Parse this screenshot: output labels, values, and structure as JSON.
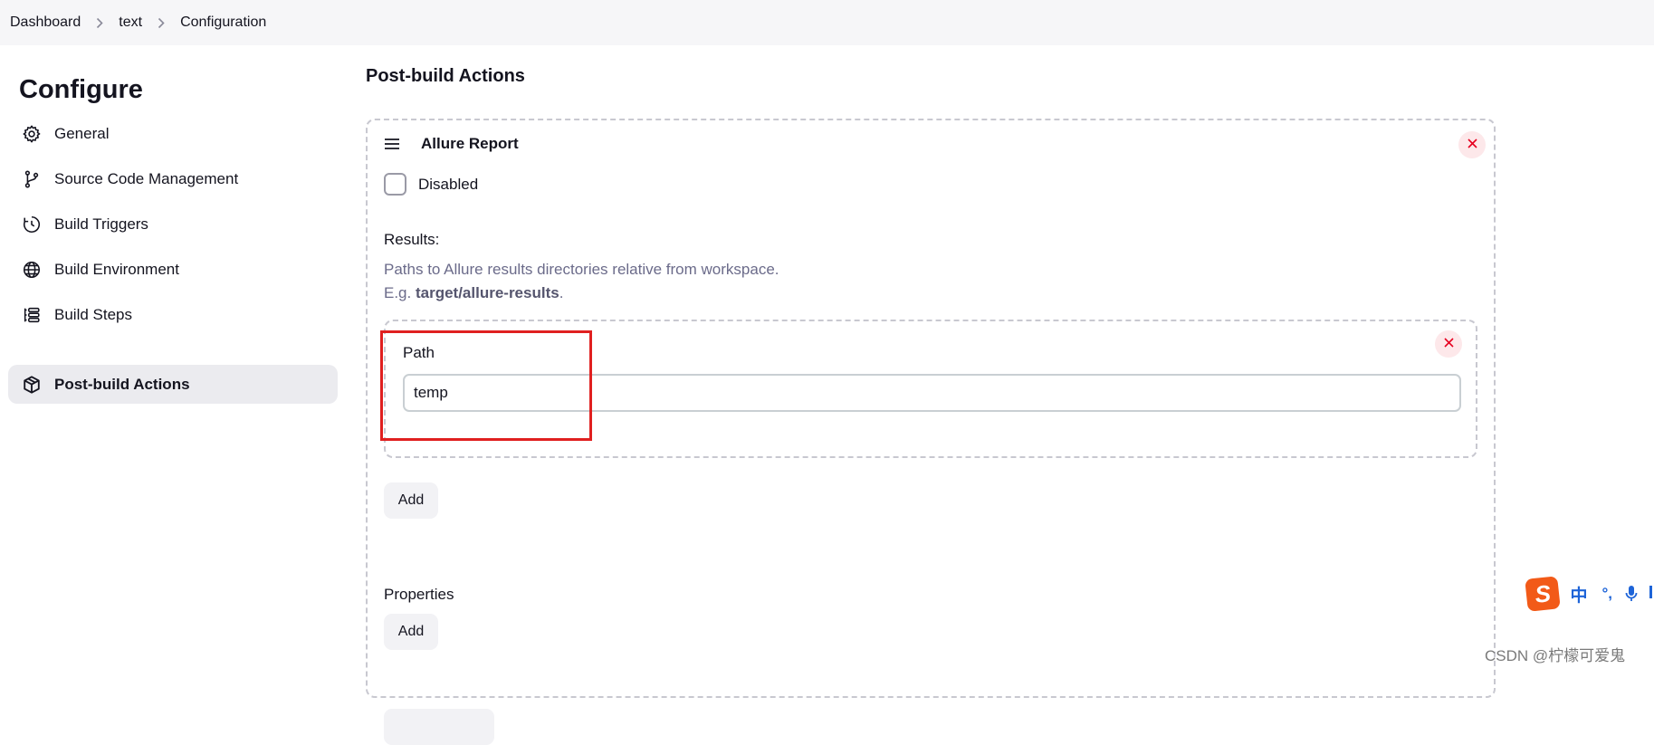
{
  "breadcrumb": {
    "items": [
      "Dashboard",
      "text",
      "Configuration"
    ]
  },
  "sidebar": {
    "title": "Configure",
    "items": [
      {
        "label": "General",
        "icon": "gear-icon"
      },
      {
        "label": "Source Code Management",
        "icon": "branch-icon"
      },
      {
        "label": "Build Triggers",
        "icon": "clock-icon"
      },
      {
        "label": "Build Environment",
        "icon": "globe-icon"
      },
      {
        "label": "Build Steps",
        "icon": "list-icon"
      },
      {
        "label": "Post-build Actions",
        "icon": "package-icon",
        "active": true
      }
    ]
  },
  "main": {
    "section_title": "Post-build Actions",
    "card": {
      "title": "Allure Report",
      "disabled_label": "Disabled",
      "disabled_checked": false,
      "results_label": "Results:",
      "help_line1": "Paths to Allure results directories relative from workspace.",
      "help_prefix": "E.g. ",
      "help_example": "target/allure-results",
      "help_suffix": ".",
      "path": {
        "label": "Path",
        "value": "temp"
      },
      "add_label": "Add",
      "properties_label": "Properties",
      "properties_add_label": "Add"
    }
  },
  "ime": {
    "logo": "S",
    "mode": "中",
    "punct": "°,"
  },
  "watermark": "CSDN @柠檬可爱鬼",
  "colors": {
    "highlight": "#e02020",
    "close": "#e6001f",
    "ime_brand": "#f25a18"
  }
}
